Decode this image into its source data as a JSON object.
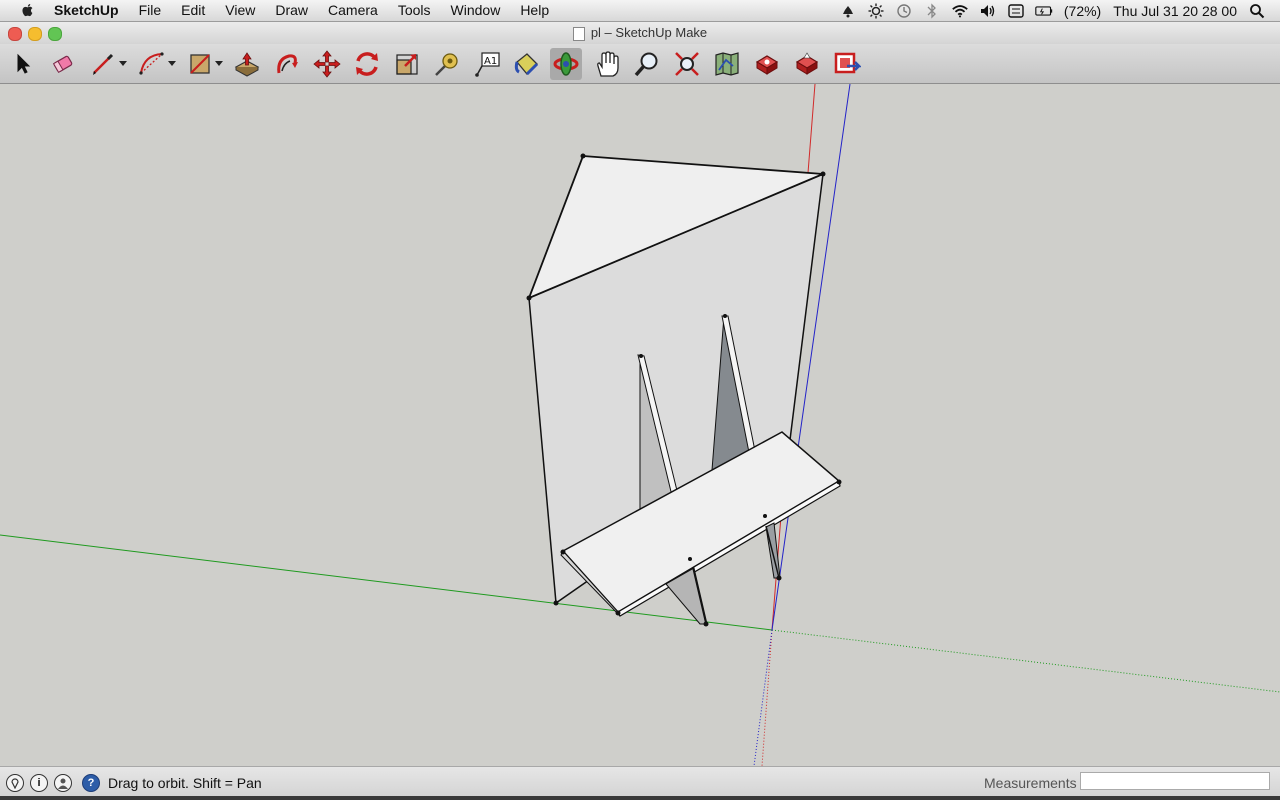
{
  "menubar": {
    "app_name": "SketchUp",
    "items": [
      "File",
      "Edit",
      "View",
      "Draw",
      "Camera",
      "Tools",
      "Window",
      "Help"
    ],
    "battery": "(72%)",
    "clock": "Thu Jul 31  20 28 00"
  },
  "window": {
    "title": "pl – SketchUp Make"
  },
  "toolbar": {
    "tools": [
      "select",
      "eraser",
      "pencil-line",
      "arc",
      "rectangle",
      "push-pull",
      "follow-me",
      "move",
      "rotate",
      "scale",
      "tape-measure",
      "text",
      "paint-bucket",
      "orbit",
      "pan",
      "zoom",
      "zoom-extents",
      "previous-view",
      "get-models",
      "share-model",
      "extension-warehouse"
    ],
    "active_tool": "orbit"
  },
  "statusbar": {
    "message": "Drag to orbit.  Shift = Pan",
    "measurements_label": "Measurements",
    "measurements_value": ""
  },
  "colors": {
    "axis_red": "#d12a2a",
    "axis_green": "#1f9a1f",
    "axis_blue": "#2323c8",
    "background": "#cfcfcb"
  }
}
